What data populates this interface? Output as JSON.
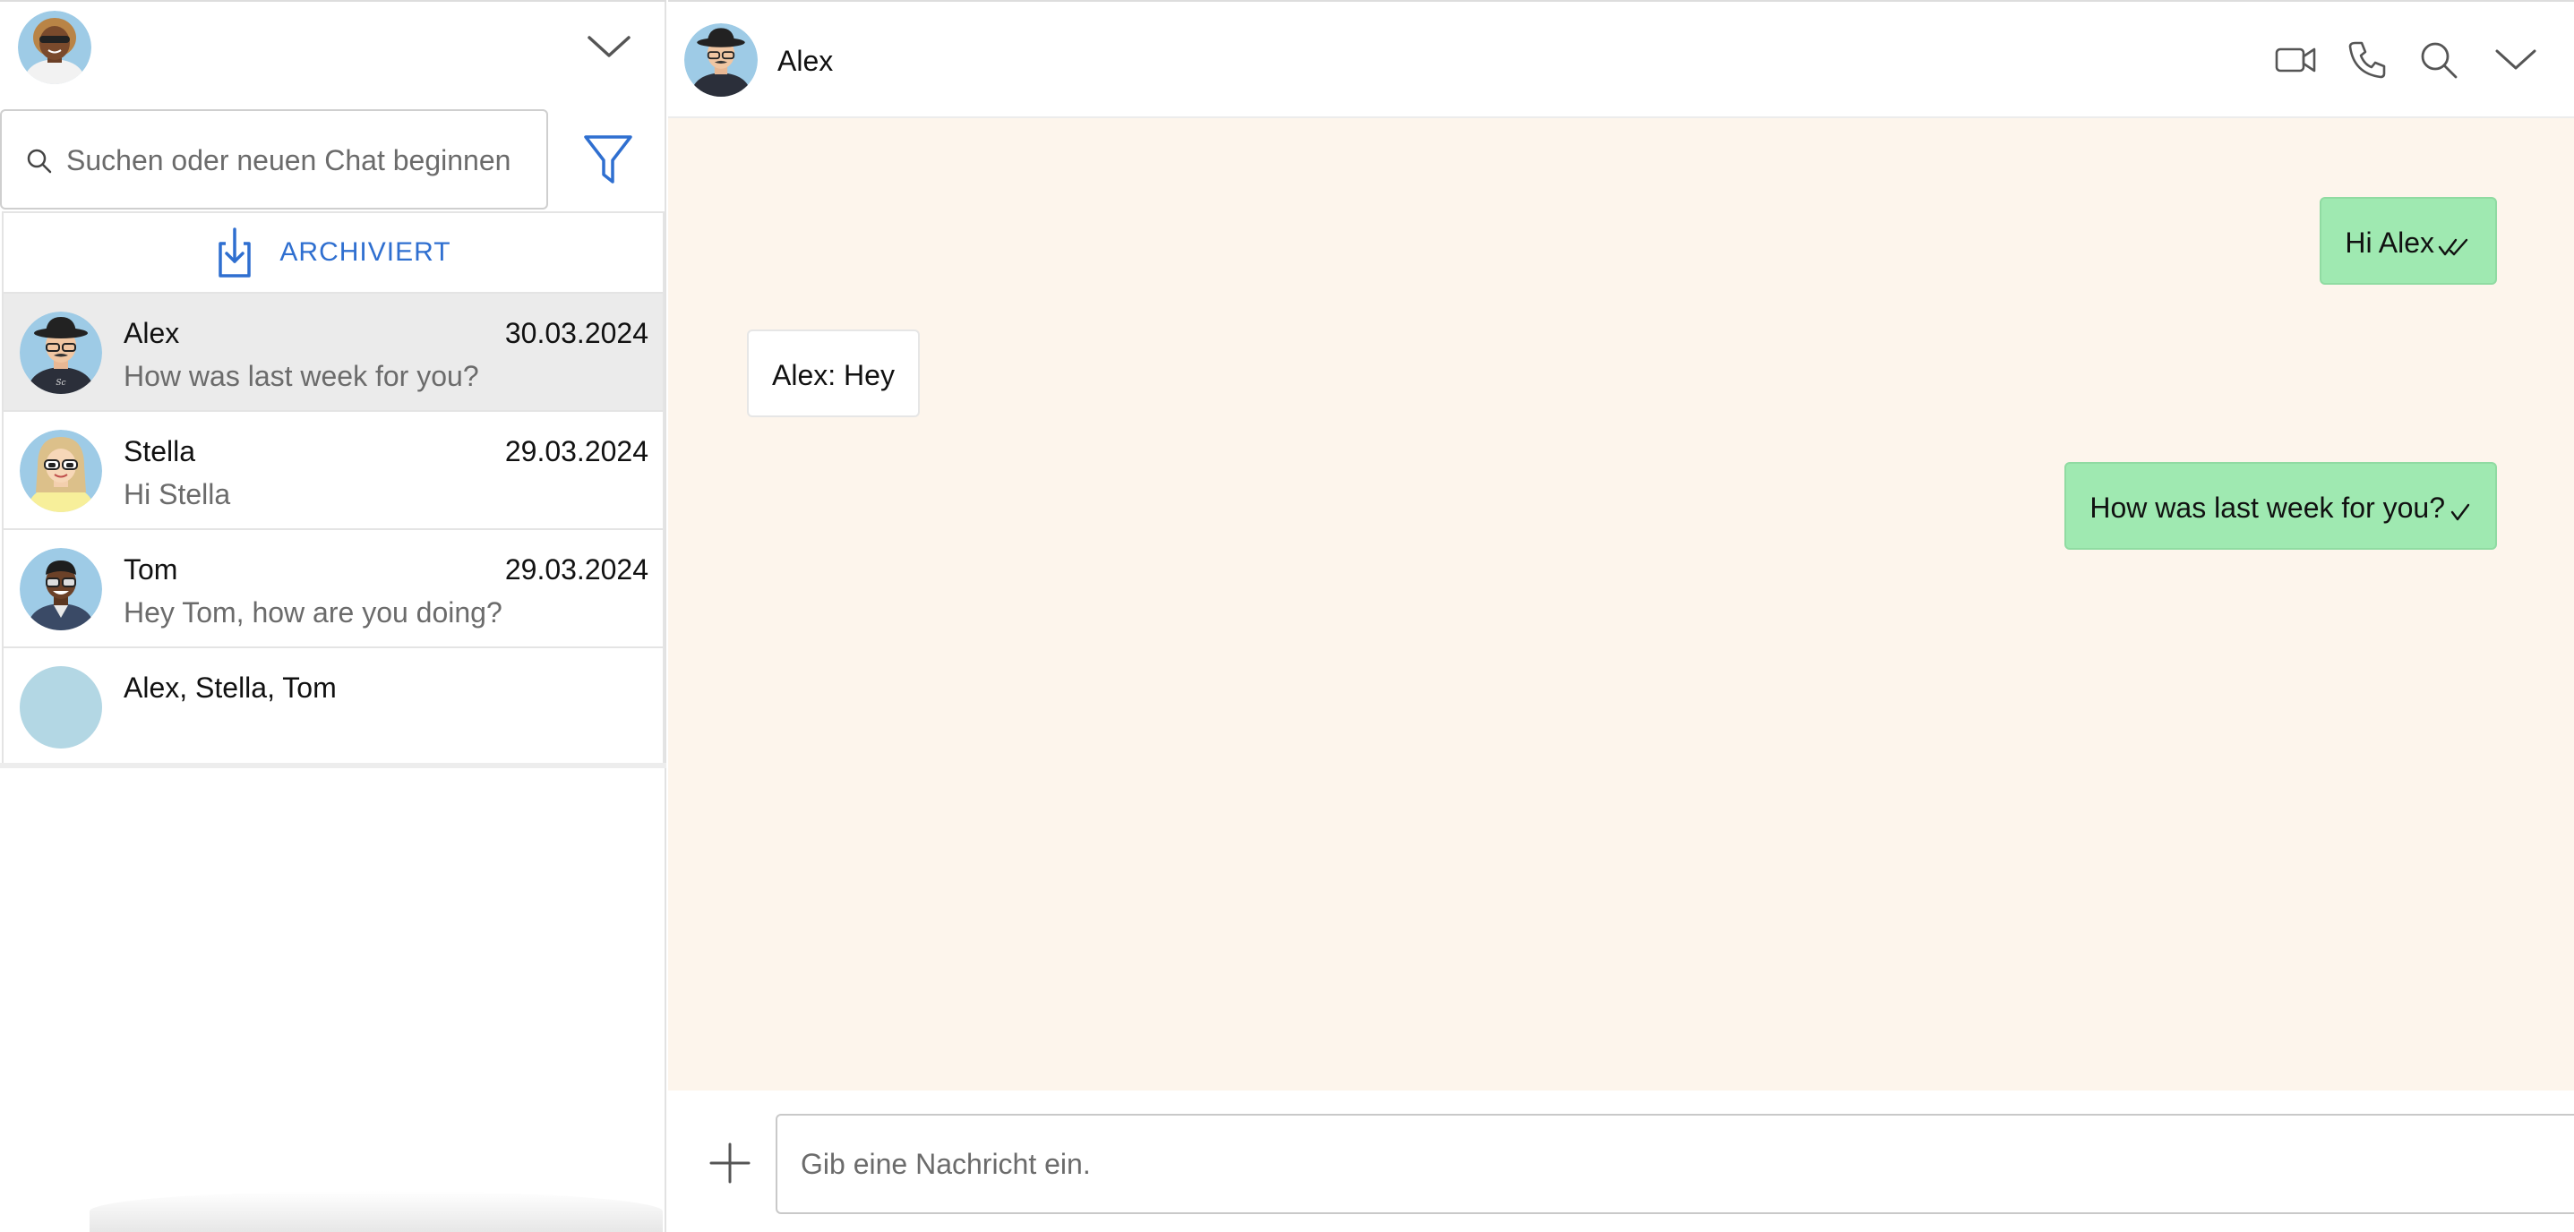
{
  "sidebar": {
    "search_placeholder": "Suchen oder neuen Chat beginnen",
    "archived_label": "ARCHIVIERT",
    "chats": [
      {
        "name": "Alex",
        "date": "30.03.2024",
        "preview": "How was last week for you?",
        "active": true
      },
      {
        "name": "Stella",
        "date": "29.03.2024",
        "preview": "Hi Stella"
      },
      {
        "name": "Tom",
        "date": "29.03.2024",
        "preview": "Hey Tom, how are you doing?"
      },
      {
        "name": "Alex, Stella, Tom",
        "date": "",
        "preview": ""
      }
    ]
  },
  "conversation": {
    "contact_name": "Alex",
    "header_icons": [
      "video-call-icon",
      "phone-icon",
      "search-icon",
      "chevron-down-icon"
    ],
    "messages": [
      {
        "direction": "outgoing",
        "text": "Hi Alex",
        "status": "read"
      },
      {
        "direction": "incoming",
        "text": "Alex: Hey"
      },
      {
        "direction": "outgoing",
        "text": "How was last week for you?",
        "status": "sent"
      }
    ],
    "composer_placeholder": "Gib eine Nachricht ein."
  },
  "colors": {
    "accent": "#2f6fd0",
    "outgoing_bubble": "#9fe9b1",
    "chat_background": "#fdf5ec",
    "active_chat": "#ebebeb"
  }
}
